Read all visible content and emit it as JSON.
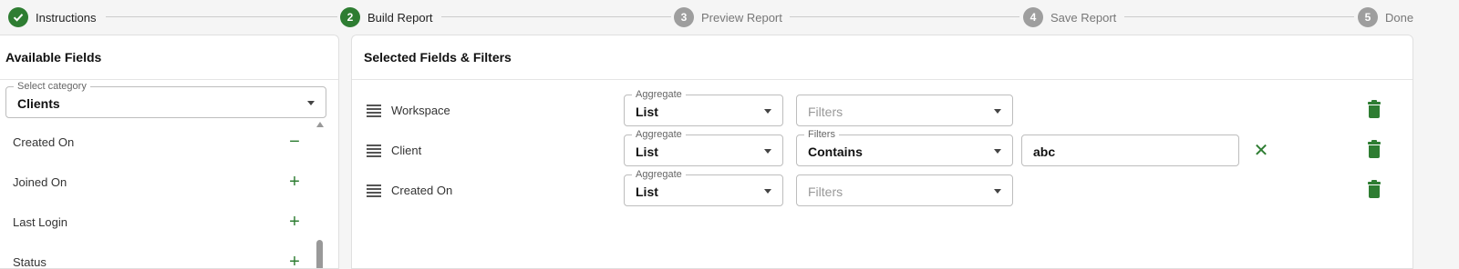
{
  "stepper": {
    "steps": [
      {
        "number": "",
        "label": "Instructions",
        "state": "done"
      },
      {
        "number": "2",
        "label": "Build Report",
        "state": "active"
      },
      {
        "number": "3",
        "label": "Preview Report",
        "state": "idle"
      },
      {
        "number": "4",
        "label": "Save Report",
        "state": "idle"
      },
      {
        "number": "5",
        "label": "Done",
        "state": "idle"
      }
    ]
  },
  "available_fields": {
    "title": "Available Fields",
    "category": {
      "label": "Select category",
      "value": "Clients"
    },
    "items": [
      {
        "label": "Created On",
        "action": "−"
      },
      {
        "label": "Joined On",
        "action": "+"
      },
      {
        "label": "Last Login",
        "action": "+"
      },
      {
        "label": "Status",
        "action": "+"
      }
    ]
  },
  "selected": {
    "title": "Selected Fields & Filters",
    "rows": [
      {
        "name": "Workspace",
        "aggregate_label": "Aggregate",
        "aggregate": "List",
        "filter_label": "",
        "filter": "",
        "filter_placeholder": "Filters",
        "value": ""
      },
      {
        "name": "Client",
        "aggregate_label": "Aggregate",
        "aggregate": "List",
        "filter_label": "Filters",
        "filter": "Contains",
        "filter_placeholder": "",
        "value": "abc"
      },
      {
        "name": "Created On",
        "aggregate_label": "Aggregate",
        "aggregate": "List",
        "filter_label": "",
        "filter": "",
        "filter_placeholder": "Filters",
        "value": ""
      }
    ]
  },
  "icons": {
    "check": "check-icon",
    "drag": "drag-handle-icon",
    "trash": "trash-icon",
    "clear": "close-icon"
  },
  "colors": {
    "accent": "#2e7d32",
    "step_idle": "#9e9e9e"
  }
}
